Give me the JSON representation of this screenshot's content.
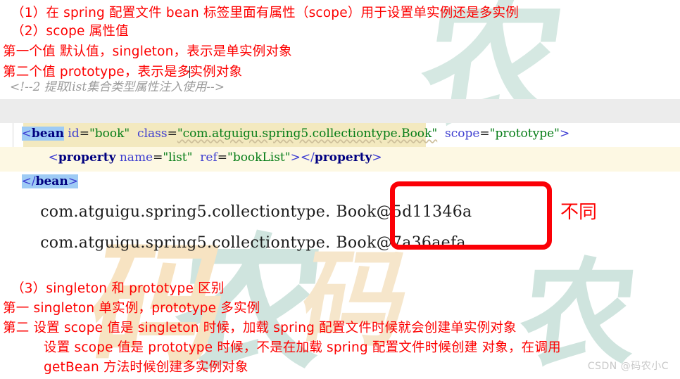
{
  "page": {
    "background": "#ffffff",
    "accent_red": "#fd0000",
    "comment_gray": "#9b9b9b",
    "string_green": "#067d17",
    "tag_blue": "#000080",
    "match_highlight": "#9ecbf5",
    "code_line_gray": "#ececec",
    "code_line_cream": "#f3e9bf",
    "code_line_cream_light": "#fdf8e3"
  },
  "notes_top": {
    "line1": "（1）在 spring 配置文件 bean 标签里面有属性（scope）用于设置单实例还是多实例",
    "line2": "（2）scope 属性值",
    "line3": "第一个值  默认值，singleton，表示是单实例对象",
    "line4a": "第二个值  prototype，表示是多",
    "line4b": "实例对象"
  },
  "code": {
    "comment": "<!--2 提取list集合类型属性注入使用-->",
    "line1": {
      "open_bracket": "<",
      "tag": "bean",
      "attr1_name": " id",
      "attr1_eq": "=",
      "attr1_val": "\"book\"",
      "attr2_name": "  class",
      "attr2_eq": "=",
      "attr2_val": "\"com.atguigu.spring5.collectiontype.Book\"",
      "attr3_name": "  scope",
      "attr3_eq": "=",
      "attr3_val": "\"prototype\"",
      "close_bracket": ">"
    },
    "line2": {
      "open_bracket": "<",
      "tag": "property",
      "attr1_name": " name",
      "attr1_eq": "=",
      "attr1_val": "\"list\"",
      "attr2_name": "  ref",
      "attr2_eq": "=",
      "attr2_val": "\"bookList\"",
      "close_bracket": ">",
      "end_open": "</",
      "end_tag": "property",
      "end_close": ">"
    },
    "line3": {
      "open_bracket": "</",
      "tag": "bean",
      "close_bracket": ">"
    }
  },
  "console": {
    "line1_prefix": "com.atguigu.spring5.collectiontype.",
    "line1_hash": "Book@5d11346a",
    "line2_prefix": "com.atguigu.spring5.collectiontype.",
    "line2_hash": "Book@7a36aefa",
    "annotation": "不同"
  },
  "notes_bottom": {
    "line1": "（3）singleton 和 prototype 区别",
    "line2": "第一  singleton 单实例，prototype 多实例",
    "line3": "第二  设置 scope 值是 singleton 时候，加载 spring 配置文件时候就会创建单实例对象",
    "line4": "设置 scope 值是 prototype 时候，不是在加载 spring 配置文件时候创建 对象，在调用",
    "line5": "getBean 方法时候创建多实例对象"
  },
  "watermark": {
    "csdn": "CSDN @码农小C",
    "glyph_main": "农",
    "glyph_alt": "码"
  }
}
